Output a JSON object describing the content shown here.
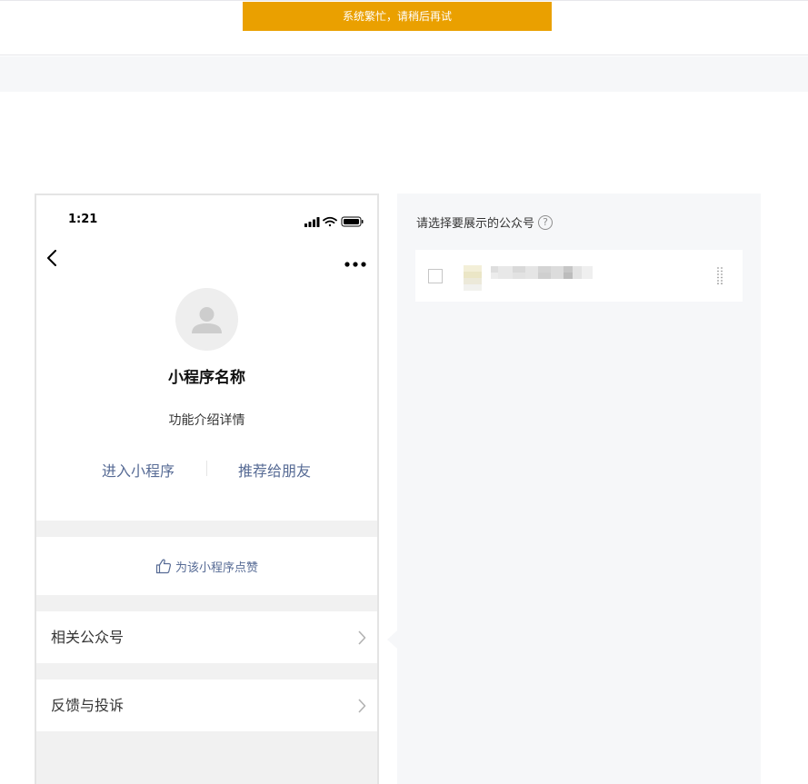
{
  "toast": {
    "message": "系统繁忙，请稍后再试",
    "color": "#eaa000"
  },
  "phone": {
    "status_time": "1:21",
    "icons": {
      "back": "back-chevron-icon",
      "more": "more-dots-icon",
      "signal": "signal-icon",
      "wifi": "wifi-icon",
      "battery": "battery-icon",
      "avatar": "default-avatar-icon"
    },
    "app_name": "小程序名称",
    "app_desc": "功能介绍详情",
    "actions": {
      "enter": "进入小程序",
      "share": "推荐给朋友"
    },
    "like_label": "为该小程序点赞",
    "rows": [
      {
        "label": "相关公众号"
      },
      {
        "label": "反馈与投诉"
      }
    ],
    "link_color": "#576b95"
  },
  "panel": {
    "title": "请选择要展示的公众号",
    "help_glyph": "?",
    "accounts": [
      {
        "checked": false
      }
    ]
  }
}
